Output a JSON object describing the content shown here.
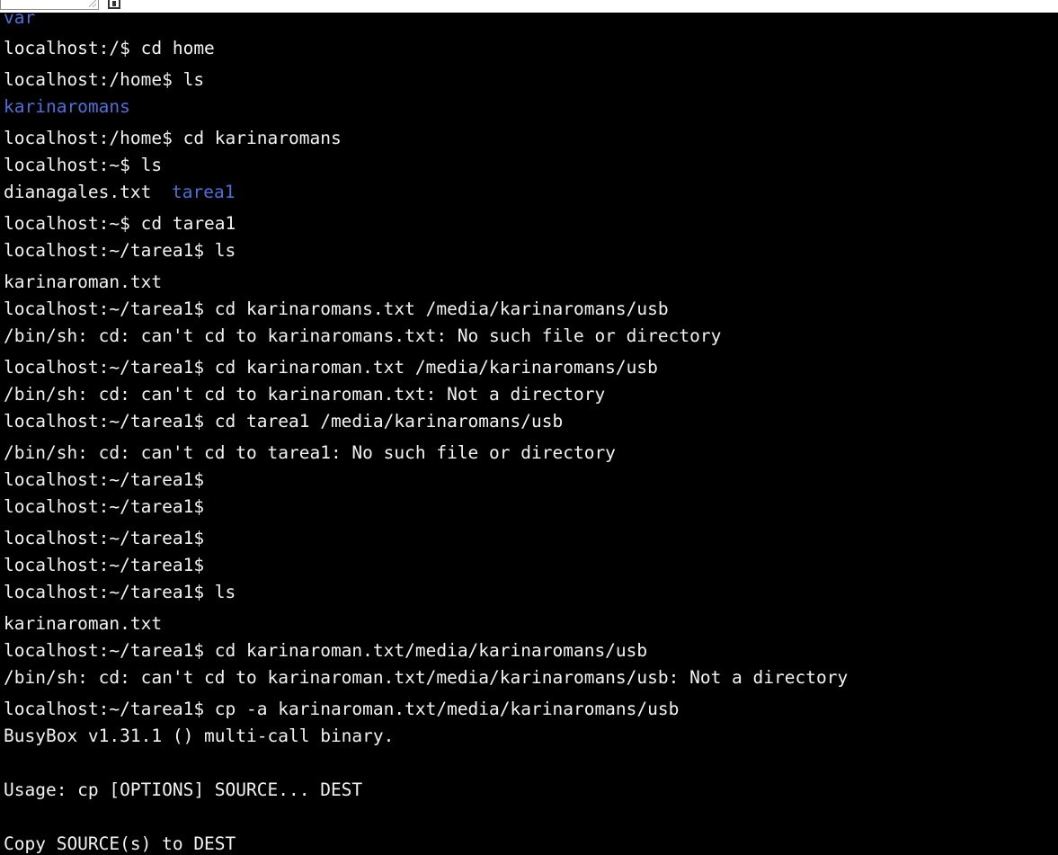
{
  "colors": {
    "background": "#000000",
    "text": "#f2f2f2",
    "directory": "#4f6fd9"
  },
  "icons": {
    "resize": "resize-grip-icon",
    "window": "small-window-icon"
  },
  "terminal": {
    "lines": [
      "var",
      "localhost:/$ cd home",
      "localhost:/home$ ls",
      "karinaromans",
      "localhost:/home$ cd karinaromans",
      "localhost:~$ ls",
      "dianagales.txt",
      "tarea1",
      "localhost:~$ cd tarea1",
      "localhost:~/tarea1$ ls",
      "karinaroman.txt",
      "localhost:~/tarea1$ cd karinaromans.txt /media/karinaromans/usb",
      "/bin/sh: cd: can't cd to karinaromans.txt: No such file or directory",
      "localhost:~/tarea1$ cd karinaroman.txt /media/karinaromans/usb",
      "/bin/sh: cd: can't cd to karinaroman.txt: Not a directory",
      "localhost:~/tarea1$ cd tarea1 /media/karinaromans/usb",
      "/bin/sh: cd: can't cd to tarea1: No such file or directory",
      "localhost:~/tarea1$",
      "localhost:~/tarea1$",
      "localhost:~/tarea1$",
      "localhost:~/tarea1$",
      "localhost:~/tarea1$ ls",
      "karinaroman.txt",
      "localhost:~/tarea1$ cd karinaroman.txt/media/karinaromans/usb",
      "/bin/sh: cd: can't cd to karinaroman.txt/media/karinaromans/usb: Not a directory",
      "localhost:~/tarea1$ cp -a karinaroman.txt/media/karinaromans/usb",
      "BusyBox v1.31.1 () multi-call binary.",
      "Usage: cp [OPTIONS] SOURCE... DEST",
      "Copy SOURCE(s) to DEST"
    ]
  }
}
